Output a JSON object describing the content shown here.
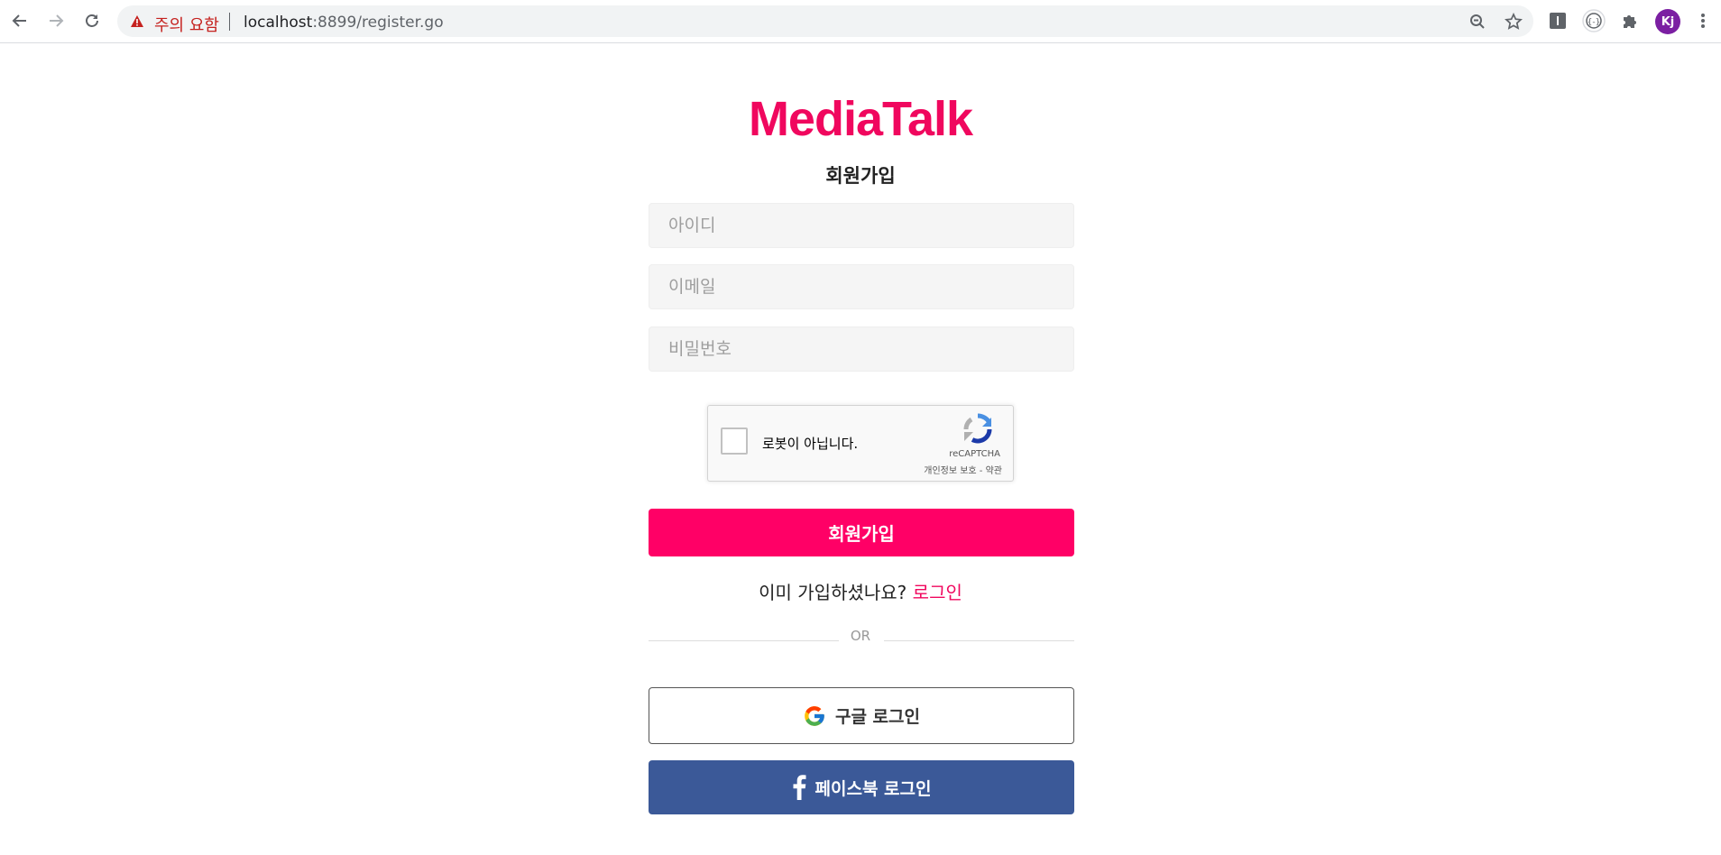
{
  "browser": {
    "security_warning": "주의 요함",
    "url_host": "localhost",
    "url_path": ":8899/register.go",
    "profile_initials": "Kj",
    "icons": {
      "back": "arrow-left-icon",
      "forward": "arrow-right-icon",
      "reload": "reload-icon",
      "warning": "warning-triangle-icon",
      "zoom": "zoom-icon",
      "bookmark": "star-icon",
      "extensions": "puzzle-icon"
    }
  },
  "page": {
    "logo": "MediaTalk",
    "title": "회원가입",
    "fields": {
      "id_placeholder": "아이디",
      "email_placeholder": "이메일",
      "password_placeholder": "비밀번호"
    },
    "recaptcha": {
      "label": "로봇이 아닙니다.",
      "brand": "reCAPTCHA",
      "terms": "개인정보 보호 - 약관"
    },
    "submit_label": "회원가입",
    "login_prompt": "이미 가입하셨나요?",
    "login_link": "로그인",
    "divider": "OR",
    "google_label": "구글 로그인",
    "facebook_label": "페이스북 로그인"
  },
  "colors": {
    "brand": "#f0075e",
    "primary_button": "#ff0066",
    "facebook": "#3b5998",
    "warning": "#c5221f"
  }
}
